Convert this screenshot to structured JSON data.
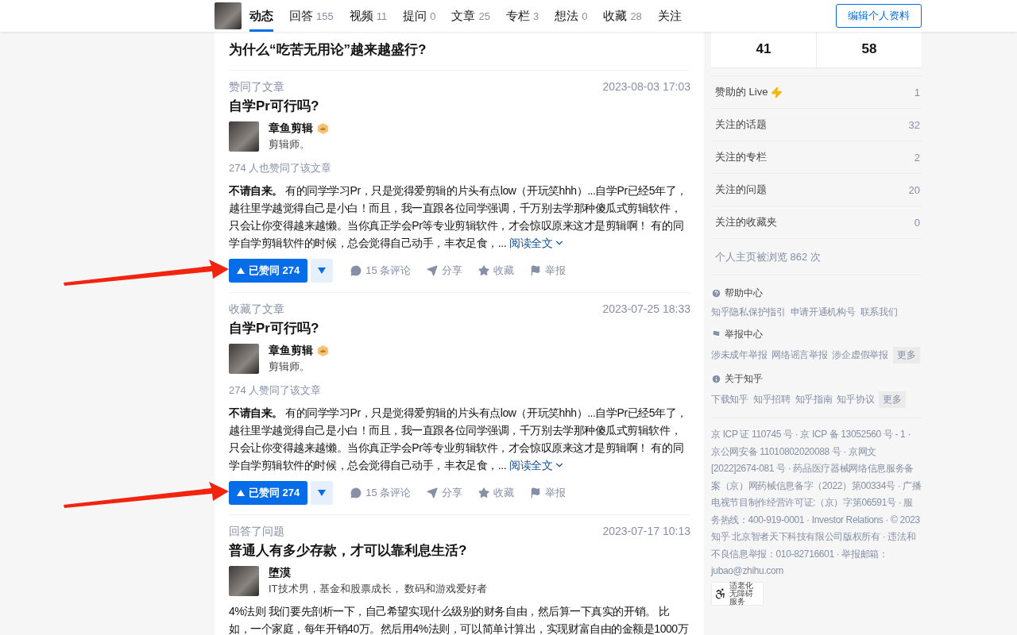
{
  "header": {
    "tabs": [
      {
        "label": "动态",
        "selected": true
      },
      {
        "label": "回答",
        "count": "155",
        "selected": false
      },
      {
        "label": "视频",
        "count": "11",
        "selected": false
      },
      {
        "label": "提问",
        "count": "0",
        "selected": false
      },
      {
        "label": "文章",
        "count": "25",
        "selected": false
      },
      {
        "label": "专栏",
        "count": "3",
        "selected": false
      },
      {
        "label": "想法",
        "count": "0",
        "selected": false
      },
      {
        "label": "收藏",
        "count": "28",
        "selected": false
      },
      {
        "label": "关注",
        "selected": false
      }
    ],
    "edit_button": "编辑个人资料"
  },
  "feed": [
    {
      "title": "为什么“吃苦无用论”越来越盛行?"
    },
    {
      "action": "赞同了文章",
      "time": "2023-08-03 17:03",
      "title": "自学Pr可行吗?",
      "author": {
        "name": "章鱼剪辑",
        "badge": true,
        "bio": "剪辑师。"
      },
      "voters": "274 人也赞同了该文章",
      "excerpt": "**不请自来。** 有的同学学习Pr，只是觉得爱剪辑的片头有点low（开玩笑hhh）...自学Pr已经5年了，越往里学越觉得自己是小白！而且，我一直跟各位同学强调，千万别去学那种傻瓜式剪辑软件，只会让你变得越来越懒。当你真正学会Pr等专业剪辑软件，才会惊叹原来这才是剪辑啊！ 有的同学自学剪辑软件的时候，总会觉得自己动手，丰衣足食，...",
      "read_more": "阅读全文",
      "actions": {
        "vote": "已赞同 274",
        "voted": true,
        "comments": "15 条评论",
        "share": "分享",
        "collect": "收藏",
        "report": "举报"
      },
      "arrow": true
    },
    {
      "action": "收藏了文章",
      "time": "2023-07-25 18:33",
      "title": "自学Pr可行吗?",
      "author": {
        "name": "章鱼剪辑",
        "badge": true,
        "bio": "剪辑师。"
      },
      "voters": "274 人赞同了该文章",
      "excerpt": "**不请自来。** 有的同学学习Pr，只是觉得爱剪辑的片头有点low（开玩笑hhh）...自学Pr已经5年了，越往里学越觉得自己是小白！而且，我一直跟各位同学强调，千万别去学那种傻瓜式剪辑软件，只会让你变得越来越懒。当你真正学会Pr等专业剪辑软件，才会惊叹原来这才是剪辑啊！ 有的同学自学剪辑软件的时候，总会觉得自己动手，丰衣足食，...",
      "read_more": "阅读全文",
      "actions": {
        "vote": "已赞同 274",
        "voted": true,
        "comments": "15 条评论",
        "share": "分享",
        "collect": "收藏",
        "report": "举报"
      },
      "arrow": true
    },
    {
      "action": "回答了问题",
      "time": "2023-07-17 10:13",
      "title": "普通人有多少存款，才可以靠利息生活?",
      "author": {
        "name": "堕漠",
        "badge": false,
        "bio": "IT技术男，基金和股票成长， 数码和游戏爱好者"
      },
      "excerpt": "4%法则 我们要先剖析一下，自己希望实现什么级别的财务自由，然后算一下真实的开销。 比如，一个家庭，每年开销40万。然后用4%法则，可以简单计算出，实现财富自由的金额是1000万"
    }
  ],
  "sidebar": {
    "stats": [
      "41",
      "58"
    ],
    "rows": [
      {
        "label": "赞助的 Live",
        "lightning": true,
        "count": "1"
      },
      {
        "label": "关注的话题",
        "lightning": false,
        "count": "32"
      },
      {
        "label": "关注的专栏",
        "lightning": false,
        "count": "2"
      },
      {
        "label": "关注的问题",
        "lightning": false,
        "count": "20"
      },
      {
        "label": "关注的收藏夹",
        "lightning": false,
        "count": "0"
      }
    ],
    "views": "个人主页被浏览 862 次",
    "sections": [
      {
        "title": "帮助中心",
        "links": [
          "知乎隐私保护指引",
          "申请开通机构号",
          "联系我们"
        ]
      },
      {
        "title": "举报中心",
        "links": [
          "涉未成年举报",
          "网络谣言举报",
          "涉企虚假举报"
        ],
        "more": "更多"
      },
      {
        "title": "关于知乎",
        "links": [
          "下载知乎",
          "知乎招聘",
          "知乎指南",
          "知乎协议"
        ],
        "more": "更多"
      }
    ],
    "legal": "京 ICP 证 110745 号 · 京 ICP 备 13052560 号 - 1 · 京公网安备 11010802020088 号 · 京网文[2022]2674-081 号 · 药品医疗器械网络信息服务备案（京）网药械信息备字（2022）第00334号 · 广播电视节目制作经营许可证:（京）字第06591号 · 服务热线：400-919-0001 · Investor Relations · © 2023 知乎 北京智者天下科技有限公司版权所有 · 违法和不良信息举报：010-82716601 · 举报邮箱：jubao@zhihu.com",
    "accessibility": [
      "适老化",
      "无障碍服务"
    ]
  }
}
